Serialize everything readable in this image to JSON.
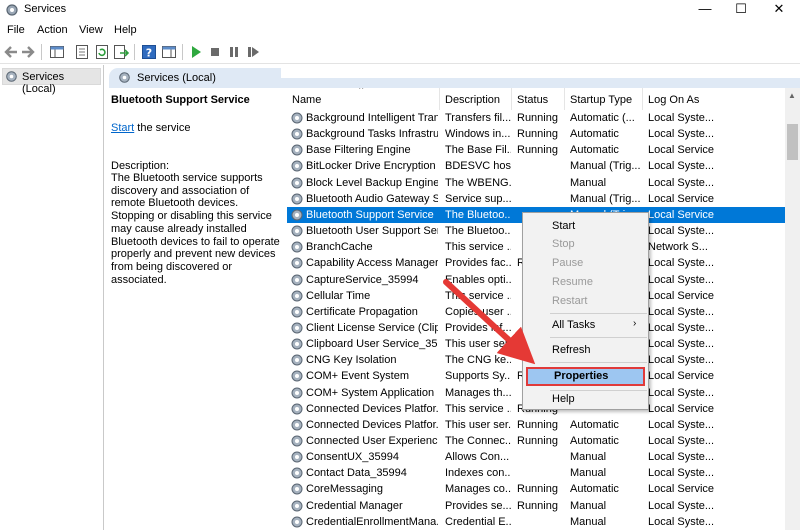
{
  "window": {
    "title": "Services",
    "minimize_label": "—",
    "maximize_label": "☐",
    "close_label": "✕"
  },
  "menu": [
    "File",
    "Action",
    "View",
    "Help"
  ],
  "toolbar": {
    "icons": [
      "back-icon",
      "forward-icon",
      "console-tree-icon",
      "properties-icon",
      "refresh-icon",
      "export-icon",
      "help-icon",
      "show-hide-icon",
      "start-service-icon",
      "stop-service-icon",
      "pause-service-icon",
      "restart-service-icon"
    ]
  },
  "tree": {
    "item_label": "Services (Local)"
  },
  "header": {
    "tab_label": "Services (Local)"
  },
  "description_pane": {
    "service_name": "Bluetooth Support Service",
    "start_link": "Start",
    "start_suffix": " the service",
    "description_label": "Description:",
    "description_text": "The Bluetooth service supports discovery and association of remote Bluetooth devices.  Stopping or disabling this service may cause already installed Bluetooth devices to fail to operate properly and prevent new devices from being discovered or associated."
  },
  "columns": [
    "Name",
    "Description",
    "Status",
    "Startup Type",
    "Log On As"
  ],
  "services": [
    {
      "name": "Background Intelligent Tran...",
      "description": "Transfers fil...",
      "status": "Running",
      "startup": "Automatic (...",
      "logon": "Local Syste..."
    },
    {
      "name": "Background Tasks Infrastruc...",
      "description": "Windows in...",
      "status": "Running",
      "startup": "Automatic",
      "logon": "Local Syste..."
    },
    {
      "name": "Base Filtering Engine",
      "description": "The Base Fil...",
      "status": "Running",
      "startup": "Automatic",
      "logon": "Local Service"
    },
    {
      "name": "BitLocker Drive Encryption ...",
      "description": "BDESVC hos...",
      "status": "",
      "startup": "Manual (Trig...",
      "logon": "Local Syste..."
    },
    {
      "name": "Block Level Backup Engine ...",
      "description": "The WBENG...",
      "status": "",
      "startup": "Manual",
      "logon": "Local Syste..."
    },
    {
      "name": "Bluetooth Audio Gateway S...",
      "description": "Service sup...",
      "status": "",
      "startup": "Manual (Trig...",
      "logon": "Local Service"
    },
    {
      "name": "Bluetooth Support Service",
      "description": "The Bluetoo...",
      "status": "",
      "startup": "Manual (Trig...",
      "logon": "Local Service"
    },
    {
      "name": "Bluetooth User Support Ser...",
      "description": "The Bluetoo...",
      "status": "",
      "startup": "",
      "logon": "Local Syste..."
    },
    {
      "name": "BranchCache",
      "description": "This service ...",
      "status": "",
      "startup": "",
      "logon": "Network S..."
    },
    {
      "name": "Capability Access Manager ...",
      "description": "Provides fac...",
      "status": "R",
      "startup": "",
      "logon": "Local Syste..."
    },
    {
      "name": "CaptureService_35994",
      "description": "Enables opti...",
      "status": "",
      "startup": "",
      "logon": "Local Syste..."
    },
    {
      "name": "Cellular Time",
      "description": "This service ...",
      "status": "",
      "startup": "",
      "logon": "Local Service"
    },
    {
      "name": "Certificate Propagation",
      "description": "Copies user ...",
      "status": "",
      "startup": "",
      "logon": "Local Syste..."
    },
    {
      "name": "Client License Service (ClipS...",
      "description": "Provides inf...",
      "status": "",
      "startup": "",
      "logon": "Local Syste..."
    },
    {
      "name": "Clipboard User Service_35994",
      "description": "This user ser...",
      "status": "",
      "startup": "",
      "logon": "Local Syste..."
    },
    {
      "name": "CNG Key Isolation",
      "description": "The CNG ke...",
      "status": "",
      "startup": "",
      "logon": "Local Syste..."
    },
    {
      "name": "COM+ Event System",
      "description": "Supports Sy...",
      "status": "R",
      "startup": "",
      "logon": "Local Service"
    },
    {
      "name": "COM+ System Application",
      "description": "Manages th...",
      "status": "",
      "startup": "",
      "logon": "Local Syste..."
    },
    {
      "name": "Connected Devices Platfor...",
      "description": "This service ...",
      "status": "Running",
      "startup": "",
      "logon": "Local Service"
    },
    {
      "name": "Connected Devices Platfor...",
      "description": "This user ser...",
      "status": "Running",
      "startup": "Automatic",
      "logon": "Local Syste..."
    },
    {
      "name": "Connected User Experience...",
      "description": "The Connec...",
      "status": "Running",
      "startup": "Automatic",
      "logon": "Local Syste..."
    },
    {
      "name": "ConsentUX_35994",
      "description": "Allows Con...",
      "status": "",
      "startup": "Manual",
      "logon": "Local Syste..."
    },
    {
      "name": "Contact Data_35994",
      "description": "Indexes con...",
      "status": "",
      "startup": "Manual",
      "logon": "Local Syste..."
    },
    {
      "name": "CoreMessaging",
      "description": "Manages co...",
      "status": "Running",
      "startup": "Automatic",
      "logon": "Local Service"
    },
    {
      "name": "Credential Manager",
      "description": "Provides se...",
      "status": "Running",
      "startup": "Manual",
      "logon": "Local Syste..."
    },
    {
      "name": "CredentialEnrollmentMana...",
      "description": "Credential E...",
      "status": "",
      "startup": "Manual",
      "logon": "Local Syste..."
    }
  ],
  "context_menu": {
    "start": "Start",
    "stop": "Stop",
    "pause": "Pause",
    "resume": "Resume",
    "restart": "Restart",
    "all_tasks": "All Tasks",
    "all_tasks_arrow": "›",
    "refresh": "Refresh",
    "properties": "Properties",
    "help": "Help"
  },
  "colors": {
    "selection": "#0078d7",
    "link": "#0066cc",
    "highlight_border": "#e03a3a",
    "arrow": "#e53935"
  }
}
